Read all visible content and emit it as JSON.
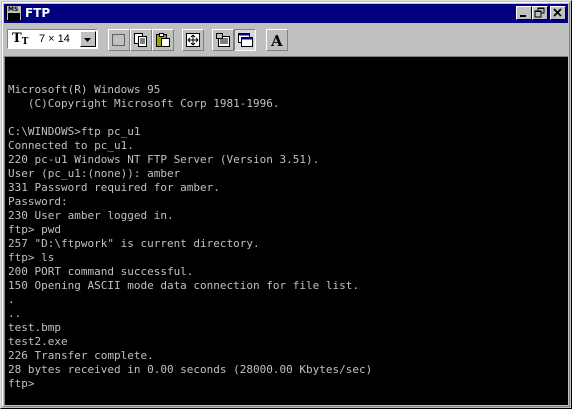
{
  "window": {
    "title": "FTP",
    "icon": "ms-dos-icon",
    "controls": [
      "minimize-icon",
      "restore-icon",
      "close-icon"
    ]
  },
  "toolbar": {
    "font_size_value": "7 × 14",
    "font_icon": "truetype-icon",
    "tools": [
      "mark-icon",
      "copy-icon",
      "paste-icon",
      "fullscreen-icon",
      "properties-icon",
      "background-icon",
      "font-icon"
    ]
  },
  "terminal": {
    "lines": [
      "",
      "",
      "Microsoft(R) Windows 95",
      "   (C)Copyright Microsoft Corp 1981-1996.",
      "",
      "C:\\WINDOWS>ftp pc_u1",
      "Connected to pc_u1.",
      "220 pc-u1 Windows NT FTP Server (Version 3.51).",
      "User (pc_u1:(none)): amber",
      "331 Password required for amber.",
      "Password:",
      "230 User amber logged in.",
      "ftp> pwd",
      "257 \"D:\\ftpwork\" is current directory.",
      "ftp> ls",
      "200 PORT command successful.",
      "150 Opening ASCII mode data connection for file list.",
      ".",
      "..",
      "test.bmp",
      "test2.exe",
      "226 Transfer complete.",
      "28 bytes received in 0.00 seconds (28000.00 Kbytes/sec)",
      "ftp>"
    ],
    "colors": {
      "background": "#000000",
      "text": "#c0c0c0"
    }
  },
  "colors": {
    "titlebar": "#000080",
    "face": "#c0c0c0"
  }
}
